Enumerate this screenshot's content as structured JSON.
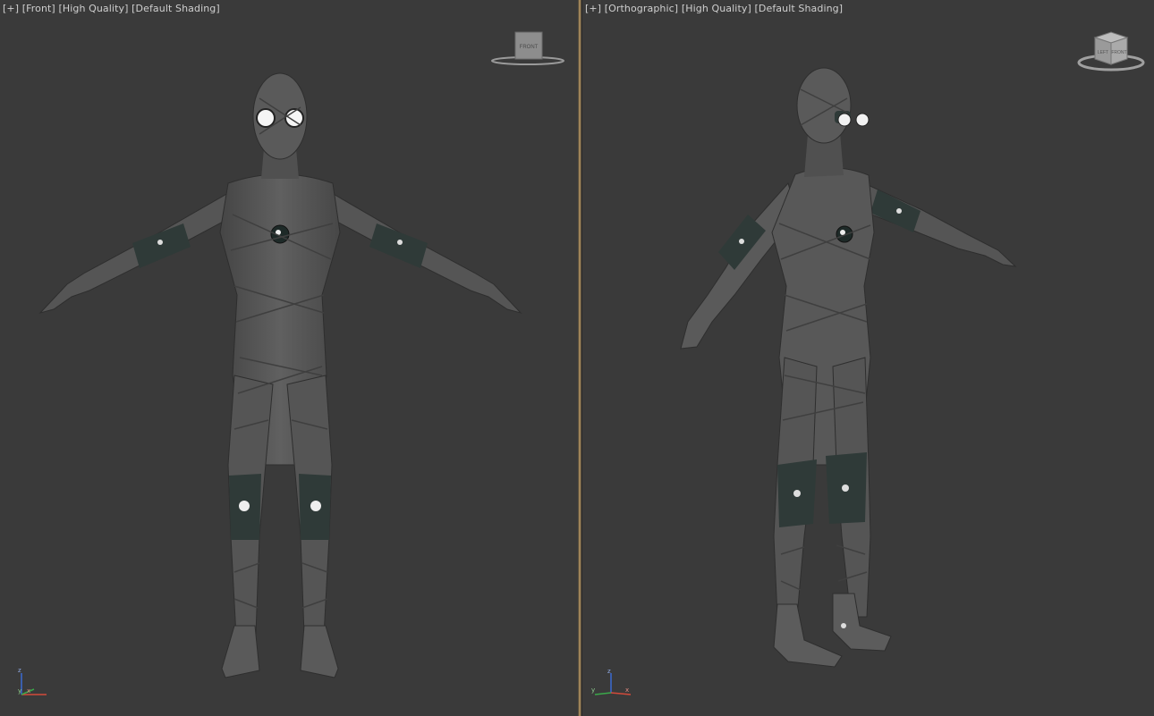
{
  "viewports": [
    {
      "menu_plus": "[+]",
      "view_name": "[Front]",
      "quality": "[High Quality]",
      "shading": "[Default Shading]",
      "viewcube_label": "FRONT",
      "axis": {
        "x": "x",
        "y": "y",
        "z": "z"
      }
    },
    {
      "menu_plus": "[+]",
      "view_name": "[Orthographic]",
      "quality": "[High Quality]",
      "shading": "[Default Shading]",
      "viewcube_label_left": "LEFT",
      "viewcube_label_right": "FRONT",
      "axis": {
        "x": "x",
        "y": "y",
        "z": "z"
      }
    }
  ],
  "colors": {
    "viewport_bg": "#3a3a3a",
    "divider_accent": "#b49460",
    "label_text": "#cfcfcf",
    "axis_x": "#d24a3a",
    "axis_y": "#3aa84a",
    "axis_z": "#3a6ad2"
  }
}
